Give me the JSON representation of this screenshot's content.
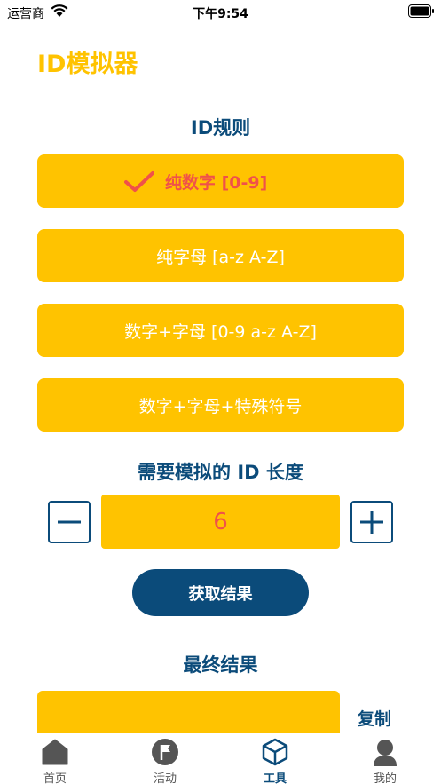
{
  "status_bar": {
    "carrier": "运营商",
    "time": "下午9:54"
  },
  "page": {
    "title": "ID模拟器"
  },
  "rules": {
    "title": "ID规则",
    "options": [
      {
        "label": "纯数字 [0-9]",
        "selected": true
      },
      {
        "label": "纯字母 [a-z A-Z]",
        "selected": false
      },
      {
        "label": "数字+字母 [0-9 a-z A-Z]",
        "selected": false
      },
      {
        "label": "数字+字母+特殊符号",
        "selected": false
      }
    ]
  },
  "length": {
    "title": "需要模拟的 ID 长度",
    "value": "6",
    "decrement_icon": "minus-icon",
    "increment_icon": "plus-icon"
  },
  "action": {
    "get_result_label": "获取结果"
  },
  "result": {
    "title": "最终结果",
    "value": "",
    "copy_label": "复制"
  },
  "tab_bar": {
    "items": [
      {
        "label": "首页",
        "icon": "home-icon"
      },
      {
        "label": "活动",
        "icon": "flag-icon"
      },
      {
        "label": "工具",
        "icon": "cube-icon",
        "active": true
      },
      {
        "label": "我的",
        "icon": "person-icon"
      }
    ]
  },
  "colors": {
    "accent": "#ffc300",
    "primary": "#0b4b7a",
    "highlight": "#f0514a"
  }
}
